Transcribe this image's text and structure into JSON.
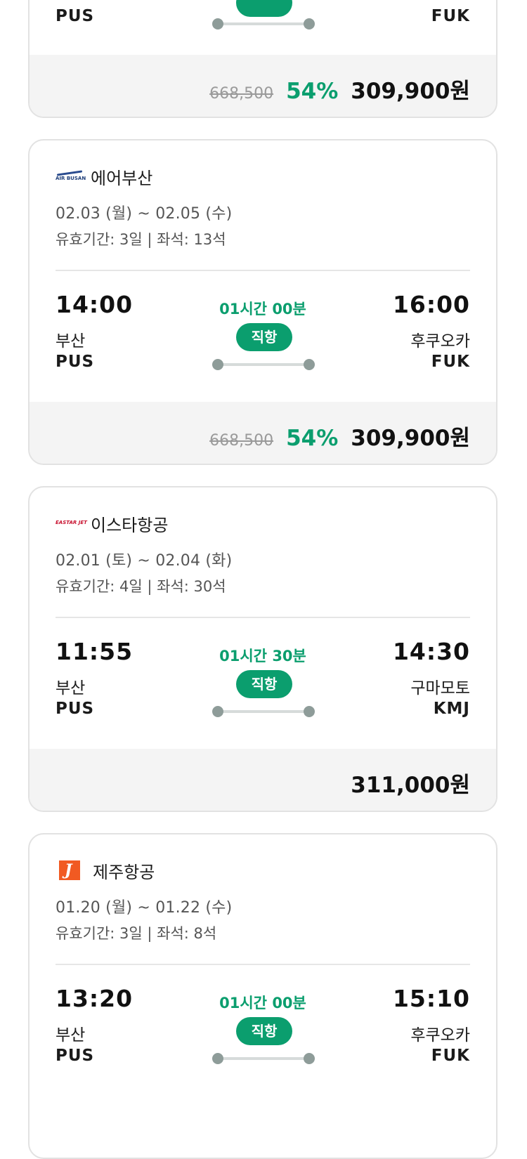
{
  "cards": [
    {
      "top_partial": true,
      "departure": {
        "code": "PUS"
      },
      "arrival": {
        "code": "FUK"
      },
      "price": {
        "original": "668,500",
        "discount": "54%",
        "final": "309,900원"
      }
    },
    {
      "airline": {
        "name": "에어부산",
        "logo_icon": "air-busan-logo-icon",
        "logo_text": "AIR BUSAN"
      },
      "dates": "02.03 (월) ~ 02.05 (수)",
      "validity": "유효기간: 3일 | 좌석: 13석",
      "departure": {
        "time": "14:00",
        "city": "부산",
        "code": "PUS"
      },
      "arrival": {
        "time": "16:00",
        "city": "후쿠오카",
        "code": "FUK"
      },
      "duration": "01시간 00분",
      "badge": "직항",
      "price": {
        "original": "668,500",
        "discount": "54%",
        "final": "309,900원"
      }
    },
    {
      "airline": {
        "name": "이스타항공",
        "logo_icon": "eastar-jet-logo-icon",
        "logo_text": "EASTAR JET"
      },
      "dates": "02.01 (토) ~ 02.04 (화)",
      "validity": "유효기간: 4일 | 좌석: 30석",
      "departure": {
        "time": "11:55",
        "city": "부산",
        "code": "PUS"
      },
      "arrival": {
        "time": "14:30",
        "city": "구마모토",
        "code": "KMJ"
      },
      "duration": "01시간 30분",
      "badge": "직항",
      "price": {
        "original": "",
        "discount": "",
        "final": "311,000원"
      }
    },
    {
      "airline": {
        "name": "제주항공",
        "logo_icon": "jeju-air-logo-icon",
        "logo_text": "J"
      },
      "dates": "01.20 (월) ~ 01.22 (수)",
      "validity": "유효기간: 3일 | 좌석: 8석",
      "departure": {
        "time": "13:20",
        "city": "부산",
        "code": "PUS"
      },
      "arrival": {
        "time": "15:10",
        "city": "후쿠오카",
        "code": "FUK"
      },
      "duration": "01시간 00분",
      "badge": "직항"
    }
  ],
  "colors": {
    "accent": "#0b9e6e",
    "price_bg": "#f4f4f4",
    "border": "#e2e2e2"
  }
}
